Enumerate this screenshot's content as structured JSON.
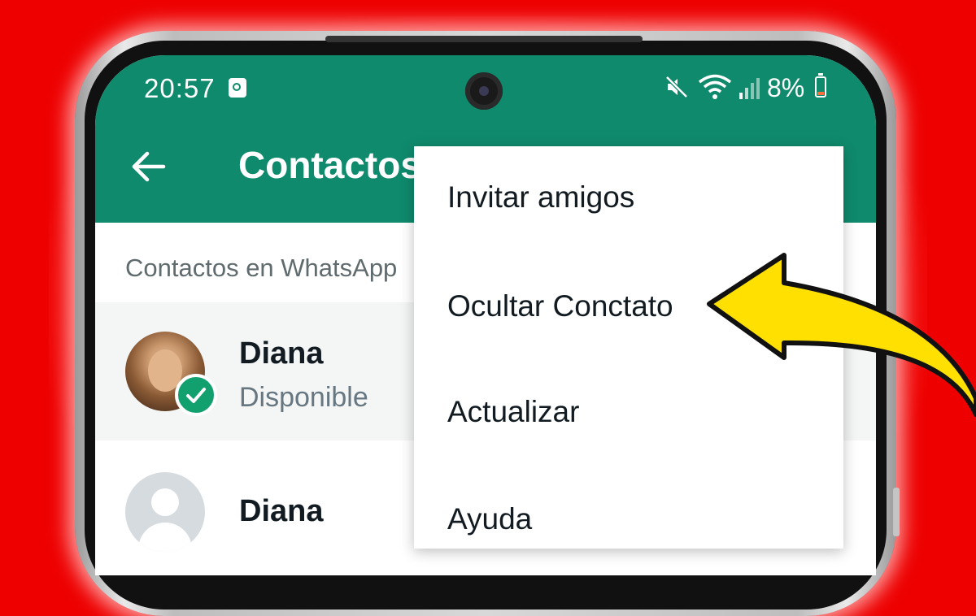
{
  "status_bar": {
    "time": "20:57",
    "icons": [
      "app-notification-icon",
      "mute-icon",
      "wifi-icon",
      "signal-icon",
      "battery-icon"
    ],
    "battery": "8%"
  },
  "toolbar": {
    "title": "Contactos"
  },
  "section": {
    "label": "Contactos en WhatsApp"
  },
  "contacts": [
    {
      "name": "Diana",
      "status": "Disponible",
      "avatar": "photo",
      "selected": true
    },
    {
      "name": "Diana",
      "status": "",
      "avatar": "default"
    }
  ],
  "menu": {
    "items": [
      {
        "label": "Invitar amigos"
      },
      {
        "label": "Ocultar Conctato"
      },
      {
        "label": "Actualizar"
      },
      {
        "label": "Ayuda"
      }
    ]
  },
  "colors": {
    "whatsapp_green": "#0f8a6c",
    "background_red": "#ee0000",
    "arrow_yellow": "#ffe000",
    "check_green": "#13a06f"
  }
}
